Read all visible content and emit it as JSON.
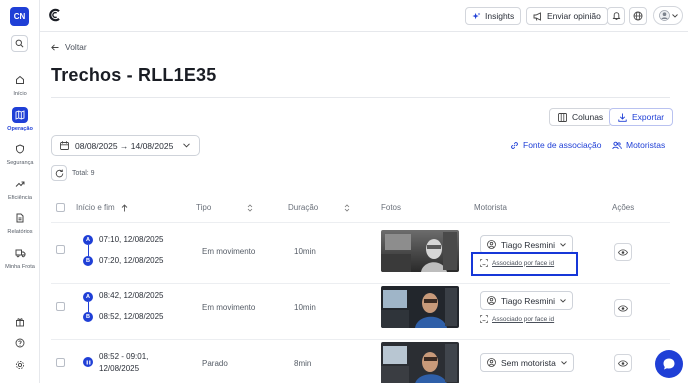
{
  "sidebar": {
    "org_initials": "CN",
    "items": [
      {
        "label": "Início",
        "icon": "home-icon"
      },
      {
        "label": "Operação",
        "icon": "map-icon",
        "active": true
      },
      {
        "label": "Segurança",
        "icon": "shield-icon"
      },
      {
        "label": "Eficiência",
        "icon": "trend-icon"
      },
      {
        "label": "Relatórios",
        "icon": "document-icon"
      },
      {
        "label": "Minha Frota",
        "icon": "truck-icon"
      }
    ]
  },
  "topbar": {
    "insights_label": "Insights",
    "feedback_label": "Enviar opinião"
  },
  "page": {
    "back_label": "Voltar",
    "title": "Trechos - RLL1E35",
    "columns_label": "Colunas",
    "export_label": "Exportar",
    "date_range": "08/08/2025 → 14/08/2025",
    "association_source_label": "Fonte de associação",
    "drivers_label": "Motoristas",
    "total_label": "Total: 9"
  },
  "table": {
    "headers": {
      "start_end": "Início e fim",
      "type": "Tipo",
      "duration": "Duração",
      "photos": "Fotos",
      "driver": "Motorista",
      "actions": "Ações"
    },
    "rows": [
      {
        "start": "07:10, 12/08/2025",
        "end": "07:20, 12/08/2025",
        "type": "Em movimento",
        "duration": "10min",
        "driver": "Tiago Resmini",
        "association": "Associado por face id"
      },
      {
        "start": "08:42, 12/08/2025",
        "end": "08:52, 12/08/2025",
        "type": "Em movimento",
        "duration": "10min",
        "driver": "Tiago Resmini",
        "association": "Associado por face id"
      },
      {
        "start_line1": "08:52 - 09:01,",
        "start_line2": "12/08/2025",
        "type": "Parado",
        "duration": "8min",
        "driver": "Sem motorista"
      }
    ],
    "pin_start": "A",
    "pin_end": "B"
  },
  "colors": {
    "accent": "#1f3fd6",
    "highlight": "#1637d8"
  }
}
